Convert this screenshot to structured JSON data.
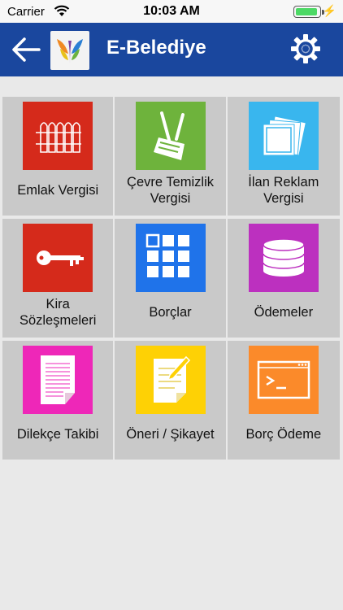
{
  "status_bar": {
    "carrier": "Carrier",
    "time": "10:03 AM"
  },
  "nav": {
    "title": "E-Belediye",
    "back_icon": "arrow-left-icon",
    "settings_icon": "gear-icon"
  },
  "colors": {
    "nav_bg": "#1a479e",
    "tile_bg": "#c9c9c9",
    "emlak": "#d52a1b",
    "cevre": "#6eb33c",
    "ilan": "#39b6ee",
    "kira": "#d52a1b",
    "borclar": "#1f73ea",
    "odemeler": "#bc30bf",
    "dilekce": "#ee27b8",
    "oneri": "#fed105",
    "borc_odeme": "#fb8a2a"
  },
  "tiles": [
    {
      "label": "Emlak Vergisi",
      "icon": "fence-icon"
    },
    {
      "label": "Çevre Temizlik\nVergisi",
      "icon": "cleaning-tools-icon"
    },
    {
      "label": "İlan Reklam\nVergisi",
      "icon": "photos-icon"
    },
    {
      "label": "Kira\nSözleşmeleri",
      "icon": "key-icon"
    },
    {
      "label": "Borçlar",
      "icon": "grid-icon"
    },
    {
      "label": "Ödemeler",
      "icon": "database-icon"
    },
    {
      "label": "Dilekçe Takibi",
      "icon": "document-icon"
    },
    {
      "label": "Öneri / Şikayet",
      "icon": "note-pencil-icon"
    },
    {
      "label": "Borç Ödeme",
      "icon": "terminal-icon"
    }
  ]
}
